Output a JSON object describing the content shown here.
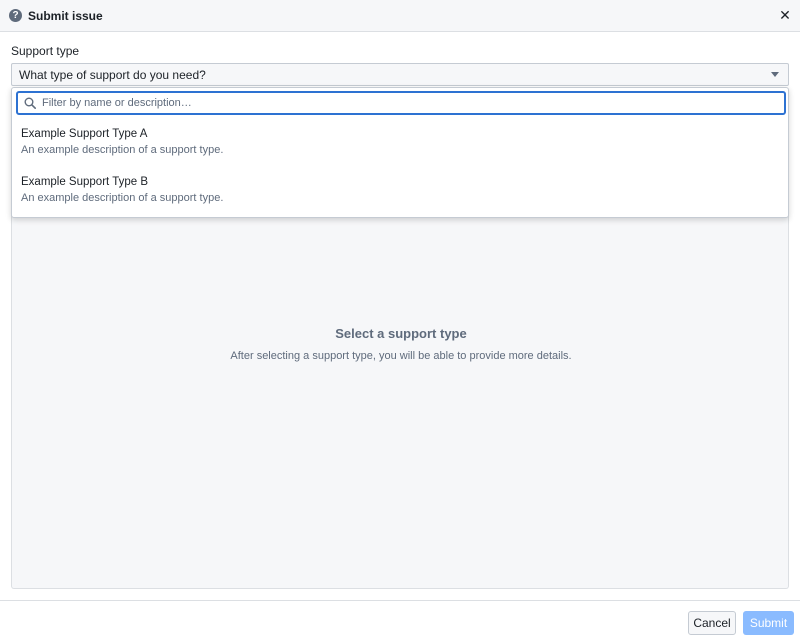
{
  "dialog": {
    "title": "Submit issue",
    "help_icon": "question-circle-icon",
    "close_icon": "close-icon",
    "close_glyph": "✕"
  },
  "form": {
    "support_type_label": "Support type",
    "select_value": "What type of support do you need?"
  },
  "dropdown": {
    "search_placeholder": "Filter by name or description…",
    "options": [
      {
        "title": "Example Support Type A",
        "description": "An example description of a support type."
      },
      {
        "title": "Example Support Type B",
        "description": "An example description of a support type."
      }
    ]
  },
  "empty_state": {
    "title": "Select a support type",
    "description": "After selecting a support type, you will be able to provide more details."
  },
  "footer": {
    "cancel_label": "Cancel",
    "submit_label": "Submit"
  },
  "colors": {
    "accent": "#2d72d2",
    "submit_disabled": "#8abbff",
    "muted_text": "#5f6b7c"
  }
}
